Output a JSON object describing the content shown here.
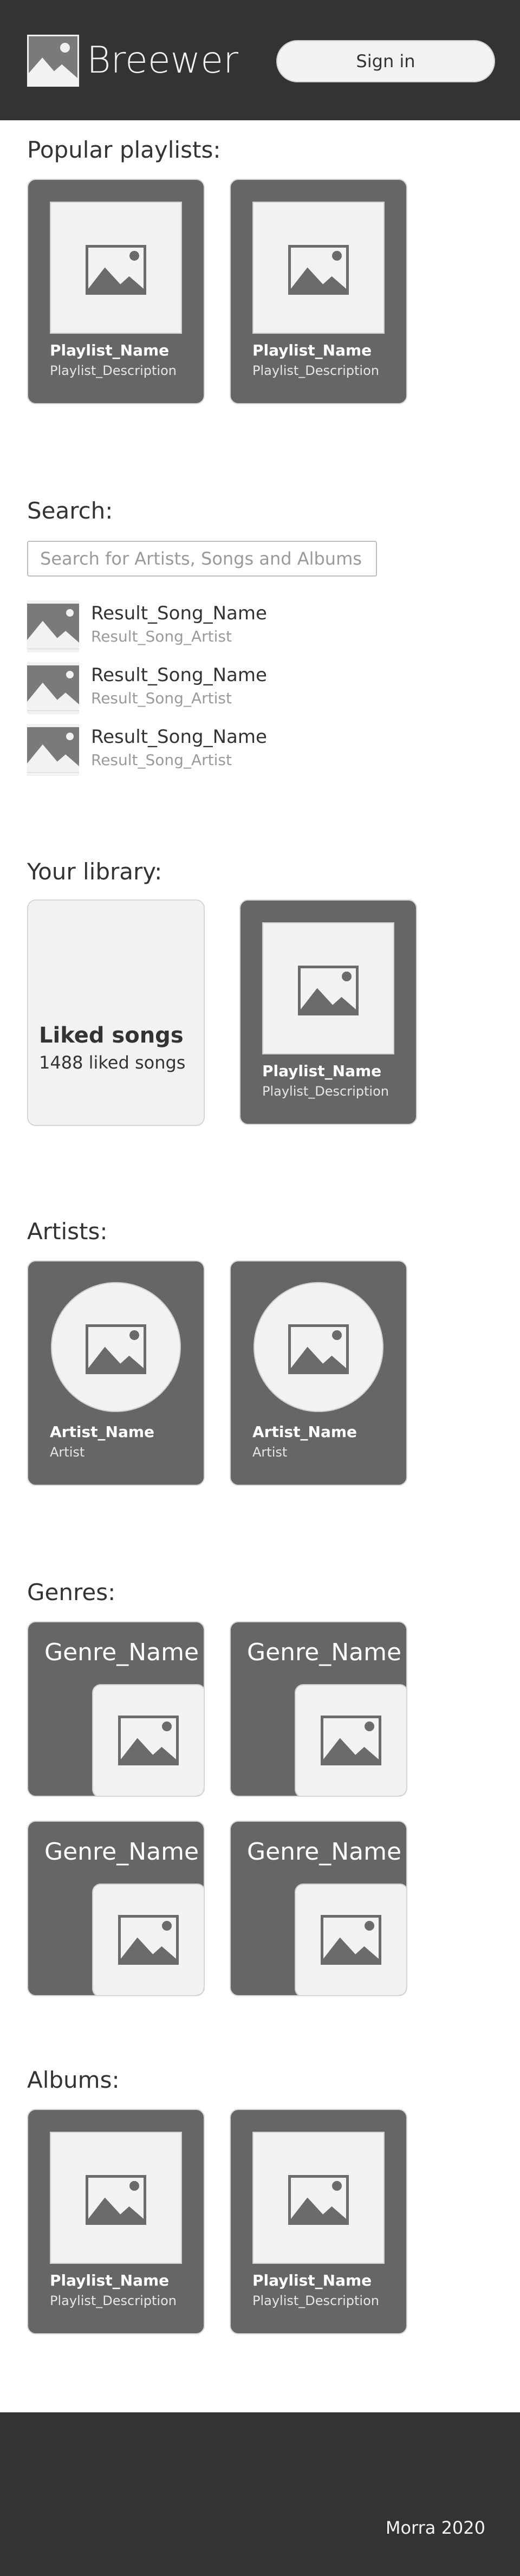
{
  "header": {
    "brand": "Breewer",
    "signin_label": "Sign in",
    "logo_icon": "image-icon"
  },
  "popular": {
    "title": "Popular playlists:",
    "items": [
      {
        "name": "Playlist_Name",
        "description": "Playlist_Description"
      },
      {
        "name": "Playlist_Name",
        "description": "Playlist_Description"
      }
    ]
  },
  "search": {
    "title": "Search:",
    "placeholder": "Search for Artists, Songs and Albums",
    "results": [
      {
        "song": "Result_Song_Name",
        "artist": "Result_Song_Artist"
      },
      {
        "song": "Result_Song_Name",
        "artist": "Result_Song_Artist"
      },
      {
        "song": "Result_Song_Name",
        "artist": "Result_Song_Artist"
      }
    ]
  },
  "library": {
    "title": "Your library:",
    "liked": {
      "title": "Liked songs",
      "count": "1488 liked songs"
    },
    "playlist": {
      "name": "Playlist_Name",
      "description": "Playlist_Description"
    }
  },
  "artists": {
    "title": "Artists:",
    "items": [
      {
        "name": "Artist_Name",
        "label": "Artist"
      },
      {
        "name": "Artist_Name",
        "label": "Artist"
      }
    ]
  },
  "genres": {
    "title": "Genres:",
    "items": [
      {
        "name": "Genre_Name"
      },
      {
        "name": "Genre_Name"
      },
      {
        "name": "Genre_Name"
      },
      {
        "name": "Genre_Name"
      }
    ]
  },
  "albums": {
    "title": "Albums:",
    "items": [
      {
        "name": "Playlist_Name",
        "description": "Playlist_Description"
      },
      {
        "name": "Playlist_Name",
        "description": "Playlist_Description"
      }
    ]
  },
  "footer": {
    "copyright": "Morra 2020"
  },
  "colors": {
    "dark": "#333333",
    "card": "#666666",
    "light": "#f2f2f2"
  }
}
